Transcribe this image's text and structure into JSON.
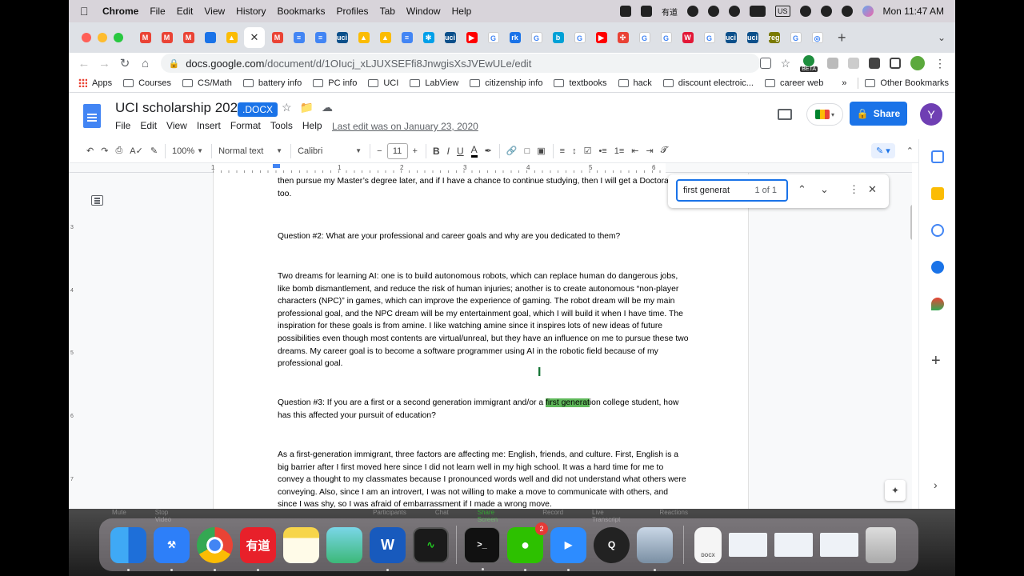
{
  "menubar": {
    "app": "Chrome",
    "items": [
      "File",
      "Edit",
      "View",
      "History",
      "Bookmarks",
      "Profiles",
      "Tab",
      "Window",
      "Help"
    ],
    "youdao": "有道",
    "input_source": "US",
    "clock": "Mon  11:47 AM"
  },
  "browser": {
    "url_host": "docs.google.com",
    "url_path": "/document/d/1OIucj_xLJUXSEFfi8JnwgisXsJVEwULe/edit",
    "beta_label": "BETA",
    "bookmarks": [
      "Apps",
      "Courses",
      "CS/Math",
      "battery info",
      "PC info",
      "UCI",
      "LabView",
      "citizenship info",
      "textbooks",
      "hack",
      "discount electroic...",
      "career web"
    ],
    "bookmarks_overflow": "»",
    "other_bookmarks": "Other Bookmarks",
    "tab_favicons": [
      "gmail",
      "gmail",
      "gmail",
      "blue-doc",
      "drive",
      "active-doc",
      "gmail",
      "docs",
      "docs",
      "uci",
      "drive",
      "drive",
      "docs",
      "fan",
      "uci",
      "youtube",
      "google",
      "rk",
      "google",
      "bilibili",
      "google",
      "youtube",
      "puzzle",
      "google",
      "google",
      "walgreens",
      "google",
      "uci",
      "uci",
      "reg",
      "google",
      "chrome"
    ]
  },
  "docs": {
    "title": "UCI scholarship 2020",
    "badge": ".DOCX",
    "menus": [
      "File",
      "Edit",
      "View",
      "Insert",
      "Format",
      "Tools",
      "Help"
    ],
    "last_edit": "Last edit was on January 23, 2020",
    "share_label": "Share",
    "avatar_letter": "Y"
  },
  "toolbar": {
    "zoom": "100%",
    "style": "Normal text",
    "font": "Calibri",
    "font_size": "11",
    "minus": "−",
    "plus": "+"
  },
  "ruler": {
    "numbers": [
      "1",
      "1",
      "2",
      "3",
      "4",
      "5",
      "6"
    ],
    "vertical_numbers": [
      "3",
      "4",
      "5",
      "6",
      "7"
    ]
  },
  "find": {
    "query": "first generat",
    "count": "1 of 1"
  },
  "document": {
    "p1": "then pursue my Master’s degree later, and if I have a chance to continue studying, then I will get a Doctorate too.",
    "q2": "Question #2: What are your professional and career goals and why are you dedicated to them?",
    "p2": "Two dreams for learning AI: one is to build autonomous robots, which can replace human do dangerous jobs, like bomb dismantlement, and reduce the risk of human injuries; another is to create autonomous “non-player characters (NPC)” in games, which can improve the experience of gaming. The robot dream will be my main professional goal, and the NPC dream will be my entertainment goal, which I will build it when I have time. The inspiration for these goals is from amine. I like watching amine since it inspires lots of new ideas of future possibilities even though most contents are virtual/unreal, but they have an influence on me to pursue these two dreams. My career goal is to become a software programmer using AI in the robotic field because of my professional goal.",
    "q3_before": "Question #3: If you are a first or a second generation immigrant and/or a ",
    "q3_highlight": "first generat",
    "q3_after": "ion college student, how has this affected your pursuit of education?",
    "p3": "As a first-generation immigrant, three factors are affecting me: English, friends, and culture. First, English is a big barrier after I first moved here since I did not learn well in my high school. It was a hard time for me to convey a thought to my classmates because I pronounced words well and did not understand what others were conveying. Also, since I am an introvert, I was not willing to make a move to communicate with others, and since I was shy, so I was afraid of embarrassment if I made a wrong move."
  },
  "zoom_controls": [
    "Mute",
    "Stop Video",
    "Participants",
    "Chat",
    "Share Screen",
    "Record",
    "Live Transcript",
    "Reactions"
  ],
  "dock": {
    "youdao": "有道",
    "wechat_badge": "2",
    "word": "W",
    "docx_label": "DOCX"
  }
}
